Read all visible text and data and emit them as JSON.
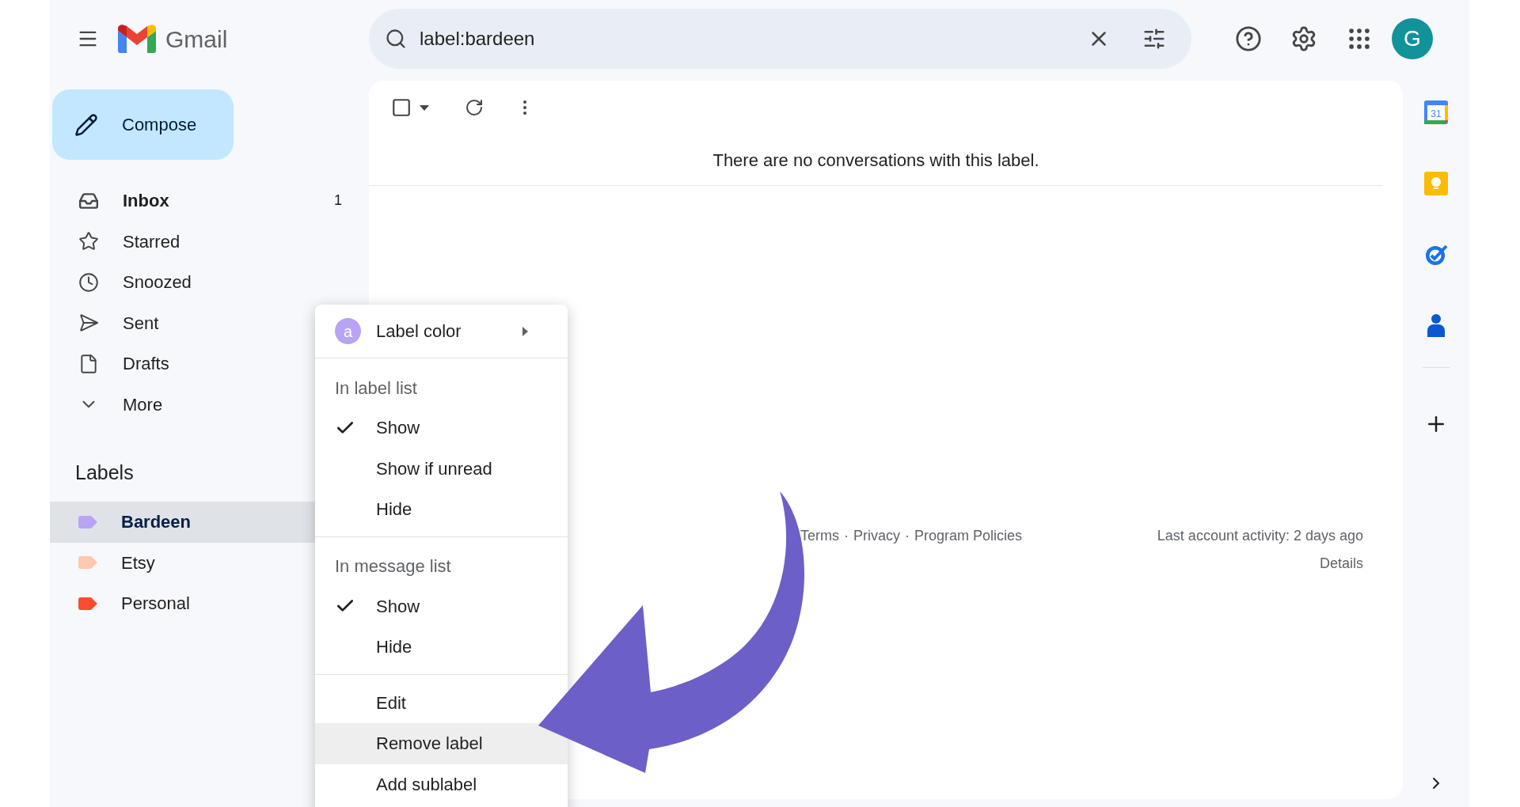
{
  "header": {
    "app_name": "Gmail",
    "search": {
      "value": "label:bardeen"
    },
    "avatar_initial": "G"
  },
  "compose": {
    "label": "Compose"
  },
  "nav": [
    {
      "label": "Inbox",
      "count": "1",
      "unread": true
    },
    {
      "label": "Starred",
      "unread": false
    },
    {
      "label": "Snoozed",
      "unread": false
    },
    {
      "label": "Sent",
      "unread": false
    },
    {
      "label": "Drafts",
      "unread": false
    },
    {
      "label": "More",
      "unread": false
    }
  ],
  "labels": {
    "heading": "Labels",
    "items": [
      {
        "name": "Bardeen",
        "color": "#b9a3f5",
        "selected": true
      },
      {
        "name": "Etsy",
        "color": "#ffc8af",
        "selected": false
      },
      {
        "name": "Personal",
        "color": "#fb4c2f",
        "selected": false
      }
    ]
  },
  "main": {
    "select_all": {
      "checked": false
    },
    "empty_message": "There are no conversations with this label.",
    "footer": {
      "links": [
        "Terms",
        "Privacy",
        "Program Policies"
      ],
      "separator": "·",
      "activity": "Last account activity: 2 days ago",
      "details": "Details"
    }
  },
  "right_rail": {
    "calendar_day": "31"
  },
  "context_menu": {
    "label_color": {
      "label": "Label color",
      "swatch_letter": "a"
    },
    "sections": [
      {
        "heading": "In label list",
        "options": [
          {
            "label": "Show",
            "checked": true
          },
          {
            "label": "Show if unread",
            "checked": false
          },
          {
            "label": "Hide",
            "checked": false
          }
        ]
      },
      {
        "heading": "In message list",
        "options": [
          {
            "label": "Show",
            "checked": true
          },
          {
            "label": "Hide",
            "checked": false
          }
        ]
      }
    ],
    "actions": [
      {
        "label": "Edit",
        "selected": false
      },
      {
        "label": "Remove label",
        "selected": true
      },
      {
        "label": "Add sublabel",
        "selected": false
      }
    ]
  }
}
